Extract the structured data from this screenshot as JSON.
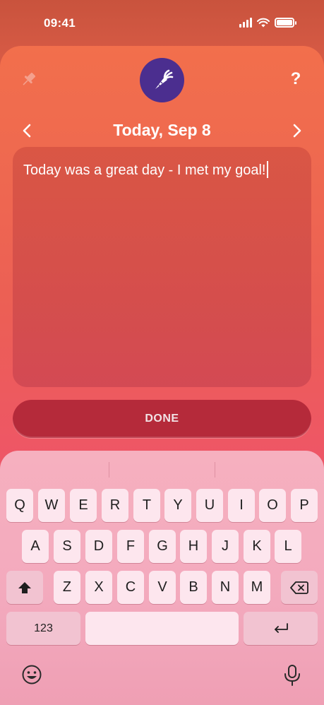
{
  "status_bar": {
    "time": "09:41"
  },
  "header": {
    "date": "Today, Sep 8"
  },
  "note": {
    "text": "Today was a great day - I met my goal!"
  },
  "done_button": {
    "label": "DONE"
  },
  "keyboard": {
    "row1": [
      "Q",
      "W",
      "E",
      "R",
      "T",
      "Y",
      "U",
      "I",
      "O",
      "P"
    ],
    "row2": [
      "A",
      "S",
      "D",
      "F",
      "G",
      "H",
      "J",
      "K",
      "L"
    ],
    "row3": [
      "Z",
      "X",
      "C",
      "V",
      "B",
      "N",
      "M"
    ],
    "numbers_label": "123"
  },
  "colors": {
    "accent_purple": "#4b2e8f",
    "done_red": "#b52a3a",
    "key_face": "#fde6ee"
  },
  "icons": [
    "pin-icon",
    "help-icon",
    "carrot-icon",
    "chevron-left-icon",
    "chevron-right-icon",
    "shift-icon",
    "delete-icon",
    "return-icon",
    "emoji-icon",
    "microphone-icon"
  ]
}
